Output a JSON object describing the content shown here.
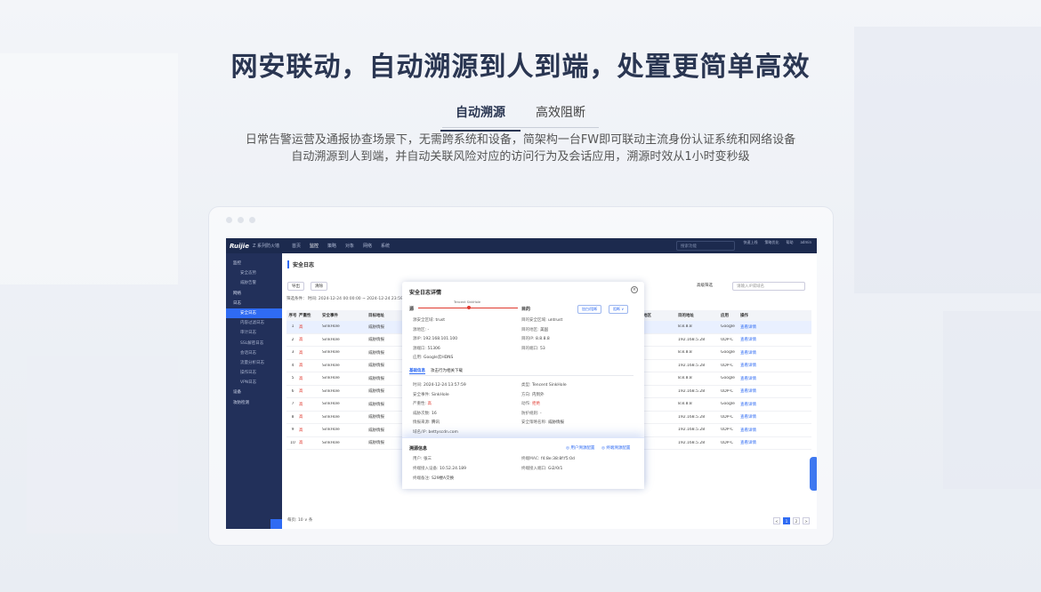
{
  "hero": {
    "title": "网安联动，自动溯源到人到端，处置更简单高效",
    "tabs": [
      {
        "label": "自动溯源",
        "active": true
      },
      {
        "label": "高效阻断",
        "active": false
      }
    ],
    "desc_line1": "日常告警运营及通报协查场景下，无需跨系统和设备，简架构一台FW即可联动主流身份认证系统和网络设备",
    "desc_line2": "自动溯源到人到端，并自动关联风险对应的访问行为及会话应用，溯源时效从1小时变秒级"
  },
  "colors": {
    "title": "#2a3652",
    "accent": "#2f6bf3",
    "nav": "#1c2a4e",
    "sidebar": "#22305a",
    "danger": "#e0382e"
  },
  "app": {
    "logo": "Ruijie",
    "logo_sub": "Z 系列防火墙",
    "nav": [
      "首页",
      "监控",
      "策略",
      "对象",
      "网络",
      "系统"
    ],
    "search_placeholder": "搜索功能",
    "nav_right": [
      "快速上线",
      "策略优化",
      "帮助",
      "admin"
    ],
    "sidebar": [
      {
        "label": "监控",
        "group": true
      },
      {
        "label": "安全态势",
        "group": false
      },
      {
        "label": "威胁告警",
        "group": false
      },
      {
        "label": "网络",
        "group": true
      },
      {
        "label": "日志",
        "group": true
      },
      {
        "label": "安全日志",
        "group": false,
        "active": true
      },
      {
        "label": "内容过滤日志",
        "group": false
      },
      {
        "label": "审计日志",
        "group": false
      },
      {
        "label": "SSL解密日志",
        "group": false
      },
      {
        "label": "会话日志",
        "group": false
      },
      {
        "label": "流量分析日志",
        "group": false
      },
      {
        "label": "操作日志",
        "group": false
      },
      {
        "label": "VPN日志",
        "group": false
      },
      {
        "label": "设备",
        "group": true
      },
      {
        "label": "攻防检测",
        "group": true
      }
    ],
    "page_title": "安全日志",
    "toolbar": {
      "export": "导出",
      "clear": "清除",
      "advanced": "高级筛选",
      "search_placeholder": "请输入IP或域名"
    },
    "filter": "筛选条件：  时间: 2024-12-24 00:00:00 ~ 2024-12-24 23:59:59",
    "columns": [
      "序号",
      "严重性",
      "安全事件",
      "目标地址",
      "目的地区",
      "目的地址",
      "应用",
      "操作"
    ],
    "rows": [
      {
        "n": "1",
        "sev": "高",
        "event": "SinkHole",
        "target": "威胁情报",
        "region": "美国",
        "dst": "8.8.8.8",
        "app": "Google",
        "op": "查看详情"
      },
      {
        "n": "2",
        "sev": "高",
        "event": "SinkHole",
        "target": "威胁情报",
        "region": "-",
        "dst": "192.168.5.28",
        "app": "UDP-C",
        "op": "查看详情"
      },
      {
        "n": "3",
        "sev": "高",
        "event": "SinkHole",
        "target": "威胁情报",
        "region": "美国",
        "dst": "8.8.8.8",
        "app": "Google",
        "op": "查看详情"
      },
      {
        "n": "4",
        "sev": "高",
        "event": "SinkHole",
        "target": "威胁情报",
        "region": "-",
        "dst": "192.168.5.28",
        "app": "UDP-C",
        "op": "查看详情"
      },
      {
        "n": "5",
        "sev": "高",
        "event": "SinkHole",
        "target": "威胁情报",
        "region": "美国",
        "dst": "8.8.8.8",
        "app": "Google",
        "op": "查看详情"
      },
      {
        "n": "6",
        "sev": "高",
        "event": "SinkHole",
        "target": "威胁情报",
        "region": "-",
        "dst": "192.168.5.28",
        "app": "UDP-C",
        "op": "查看详情"
      },
      {
        "n": "7",
        "sev": "高",
        "event": "SinkHole",
        "target": "威胁情报",
        "region": "美国",
        "dst": "8.8.8.8",
        "app": "Google",
        "op": "查看详情"
      },
      {
        "n": "8",
        "sev": "高",
        "event": "SinkHole",
        "target": "威胁情报",
        "region": "-",
        "dst": "192.168.5.28",
        "app": "UDP-C",
        "op": "查看详情"
      },
      {
        "n": "9",
        "sev": "高",
        "event": "SinkHole",
        "target": "威胁情报",
        "region": "-",
        "dst": "192.168.5.28",
        "app": "UDP-C",
        "op": "查看详情"
      },
      {
        "n": "10",
        "sev": "高",
        "event": "SinkHole",
        "target": "威胁情报",
        "region": "-",
        "dst": "192.168.5.28",
        "app": "UDP-C",
        "op": "查看详情"
      }
    ],
    "pager": "每页: 10 ∨ 条",
    "pages": [
      "<",
      "1",
      "2",
      ">"
    ]
  },
  "modal": {
    "title": "安全日志详情",
    "src": "源",
    "dst": "目的",
    "flow_label": "Tencent SinkHole",
    "btn_add": "加白/阻断",
    "btn_more": "阻断 ∨",
    "src_kv": [
      {
        "k": "源安全区域:",
        "v": "trust"
      },
      {
        "k": "源地区:",
        "v": "-"
      },
      {
        "k": "源IP:",
        "v": "192.168.101.100"
      },
      {
        "k": "源端口:",
        "v": "51306"
      },
      {
        "k": "应用:",
        "v": "Google云HDNS"
      }
    ],
    "dst_kv": [
      {
        "k": "目的安全区域:",
        "v": "untrust"
      },
      {
        "k": "目的地区:",
        "v": "美国"
      },
      {
        "k": "目的IP:",
        "v": "8.8.8.8"
      },
      {
        "k": "目的端口:",
        "v": "53"
      }
    ],
    "tabs": [
      "基础信息",
      "攻击行为相关下载"
    ],
    "detail_left": [
      {
        "k": "时间:",
        "v": "2024-12-24 13:57:59"
      },
      {
        "k": "安全事件:",
        "v": "SinkHole"
      },
      {
        "k": "严重性:",
        "v": "高"
      },
      {
        "k": "威胁次数:",
        "v": "16"
      },
      {
        "k": "情报来源:",
        "v": "腾讯"
      },
      {
        "k": "域名/IP:",
        "v": "bettyscdn.com"
      }
    ],
    "detail_right": [
      {
        "k": "类型:",
        "v": "Tencent SinkHole"
      },
      {
        "k": "方向:",
        "v": "内到外"
      },
      {
        "k": "动作:",
        "v": "拒绝"
      },
      {
        "k": "防护规则:",
        "v": "-"
      },
      {
        "k": "安全策略名称:",
        "v": "威胁情报"
      }
    ],
    "trace_title": "溯源信息",
    "trace_link1": "◎ 用户溯源配置",
    "trace_link2": "◎ 终端溯源配置",
    "trace_left": [
      {
        "k": "用户:",
        "v": "张三"
      },
      {
        "k": "终端接入设备:",
        "v": "10.52.24.189"
      },
      {
        "k": "终端备注:",
        "v": "S29楼A交换"
      }
    ],
    "trace_right": [
      {
        "k": "终端MAC:",
        "v": "f4:8e:38:8f:f5:0d"
      },
      {
        "k": "终端接入端口:",
        "v": "Gi2/0/1"
      }
    ]
  }
}
